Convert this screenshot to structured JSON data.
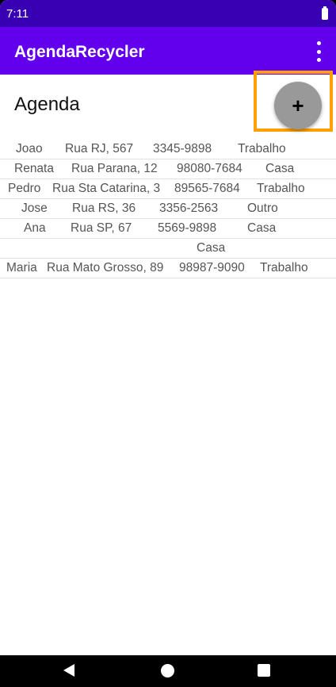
{
  "status_bar": {
    "time": "7:11"
  },
  "app_bar": {
    "title": "AgendaRecycler",
    "overflow_icon": "more-vert-icon"
  },
  "page": {
    "title": "Agenda"
  },
  "fab": {
    "label": "+",
    "highlight_color": "#ffa000"
  },
  "colors": {
    "app_bar": "#6200ee",
    "status_bar": "#3700b3",
    "fab": "#999999"
  },
  "contacts": [
    {
      "name": "Joao",
      "address": "Rua RJ, 567",
      "phone": "3345-9898",
      "type": "Trabalho"
    },
    {
      "name": "Renata",
      "address": "Rua Parana, 12",
      "phone": "98080-7684",
      "type": "Casa"
    },
    {
      "name": "Pedro",
      "address": "Rua Sta Catarina, 3",
      "phone": "89565-7684",
      "type": "Trabalho"
    },
    {
      "name": "Jose",
      "address": "Rua RS, 36",
      "phone": "3356-2563",
      "type": "Outro"
    },
    {
      "name": "Ana",
      "address": "Rua SP, 67",
      "phone": "5569-9898",
      "type": "Casa"
    },
    {
      "name": "",
      "address": "",
      "phone": "",
      "type": "Casa"
    },
    {
      "name": "Maria",
      "address": "Rua Mato Grosso, 89",
      "phone": "98987-9090",
      "type": "Trabalho"
    }
  ],
  "nav_bar": {
    "back_icon": "back-triangle-icon",
    "home_icon": "home-circle-icon",
    "recent_icon": "recent-square-icon"
  }
}
